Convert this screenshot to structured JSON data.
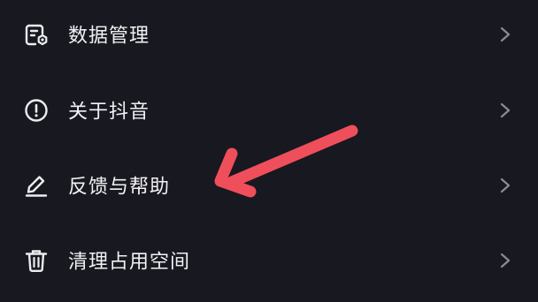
{
  "settings_menu": {
    "items": [
      {
        "label": "数据管理",
        "icon": "data-management-icon"
      },
      {
        "label": "关于抖音",
        "icon": "info-circle-icon"
      },
      {
        "label": "反馈与帮助",
        "icon": "pencil-icon"
      },
      {
        "label": "清理占用空间",
        "icon": "trash-icon"
      }
    ],
    "chevron_icon": "chevron-right-icon"
  },
  "annotation": {
    "arrow_color": "#ef4f5a",
    "points_to": "反馈与帮助"
  },
  "colors": {
    "background": "#181821",
    "text": "#f2f2f4",
    "icon": "#ececef",
    "chevron": "#8a8a92"
  }
}
